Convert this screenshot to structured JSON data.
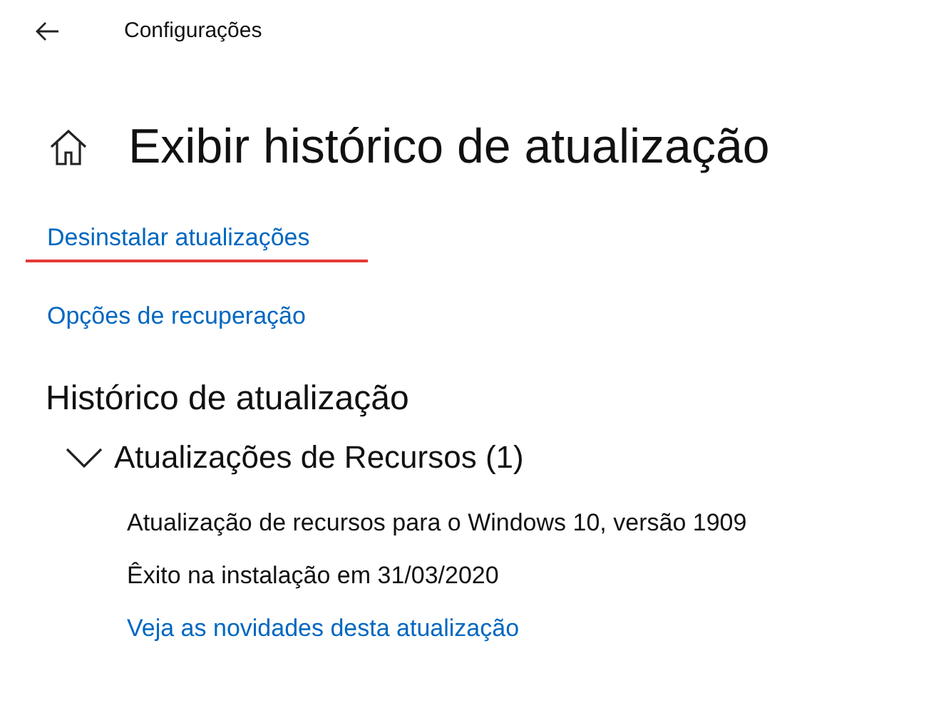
{
  "header": {
    "title": "Configurações"
  },
  "page": {
    "title": "Exibir histórico de atualização"
  },
  "links": [
    {
      "label": "Desinstalar atualizações",
      "underlined": true
    },
    {
      "label": "Opções de recuperação",
      "underlined": false
    }
  ],
  "history": {
    "heading": "Histórico de atualização",
    "groups": [
      {
        "title": "Atualizações de Recursos (1)",
        "expanded": true,
        "entries": [
          {
            "name": "Atualização de recursos para o Windows 10, versão 1909",
            "status": "Êxito na instalação em 31/03/2020",
            "link": "Veja as novidades desta atualização"
          }
        ]
      }
    ]
  }
}
